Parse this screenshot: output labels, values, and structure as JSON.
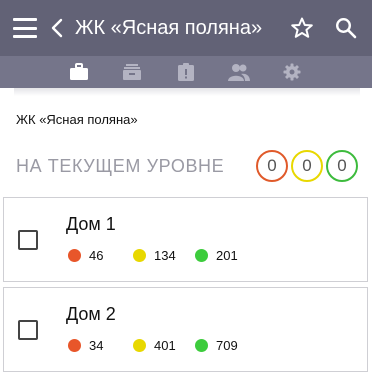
{
  "appbar": {
    "title": "ЖК «Ясная поляна»",
    "menu_icon": "hamburger-menu-icon",
    "back_icon": "chevron-left-icon",
    "star_icon": "star-outline-icon",
    "search_icon": "search-icon",
    "background": "#626276"
  },
  "tabs": [
    {
      "icon": "briefcase-icon"
    },
    {
      "icon": "inbox-tray-icon"
    },
    {
      "icon": "alert-clipboard-icon"
    },
    {
      "icon": "people-icon"
    },
    {
      "icon": "gear-icon"
    }
  ],
  "complex_name": "ЖК «Ясная поляна»",
  "level": {
    "label": "НА ТЕКУЩЕМ УРОВНЕ",
    "counters": [
      {
        "value": "0",
        "color": "#e05a2a"
      },
      {
        "value": "0",
        "color": "#e8d800"
      },
      {
        "value": "0",
        "color": "#3dbb3d"
      }
    ]
  },
  "houses": [
    {
      "title": "Дом 1",
      "red": "46",
      "yellow": "134",
      "green": "201"
    },
    {
      "title": "Дом 2",
      "red": "34",
      "yellow": "401",
      "green": "709"
    }
  ],
  "status_colors": {
    "red": "#e8562a",
    "yellow": "#e8d800",
    "green": "#3dcc3d"
  }
}
